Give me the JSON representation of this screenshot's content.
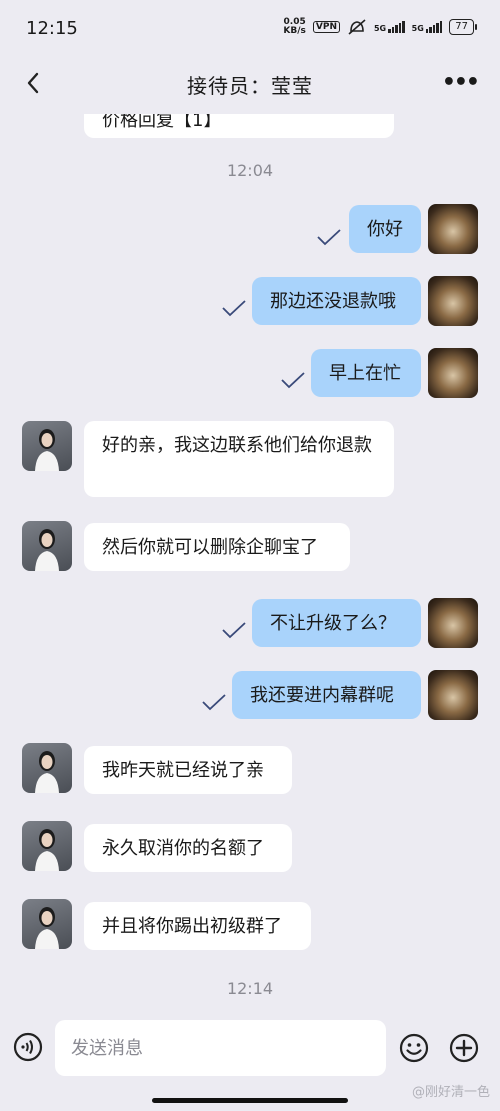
{
  "status_bar": {
    "time": "12:15",
    "net_speed_value": "0.05",
    "net_speed_unit": "KB/s",
    "vpn": "VPN",
    "sim1": "5G",
    "sim2": "5G",
    "battery": "77"
  },
  "header": {
    "title": "接待员：莹莹",
    "back_icon": "chevron-left-icon",
    "more_icon": "more-horizontal-icon"
  },
  "chat": {
    "clipped_top_text": "价格回复【1】",
    "timestamp_1": "12:04",
    "timestamp_2": "12:14",
    "messages": [
      {
        "from": "user",
        "text": "你好",
        "read": true
      },
      {
        "from": "user",
        "text": "那边还没退款哦",
        "read": true
      },
      {
        "from": "user",
        "text": "早上在忙",
        "read": true
      },
      {
        "from": "agent",
        "text": "好的亲，我这边联系他们给你退款"
      },
      {
        "from": "agent",
        "text": "然后你就可以删除企聊宝了"
      },
      {
        "from": "user",
        "text": "不让升级了么？",
        "read": true
      },
      {
        "from": "user",
        "text": "我还要进内幕群呢",
        "read": true
      },
      {
        "from": "agent",
        "text": "我昨天就已经说了亲"
      },
      {
        "from": "agent",
        "text": "永久取消你的名额了"
      },
      {
        "from": "agent",
        "text": "并且将你踢出初级群了"
      }
    ]
  },
  "composer": {
    "placeholder": "发送消息",
    "voice_icon": "voice-icon",
    "emoji_icon": "emoji-icon",
    "plus_icon": "plus-icon"
  },
  "watermark": "@刚好清一色",
  "colors": {
    "background": "#ECEBF2",
    "outgoing_bubble": "#A9D3FB",
    "incoming_bubble": "#FFFFFF",
    "read_check": "#3A4A7A",
    "timestamp": "#8A8A92"
  }
}
